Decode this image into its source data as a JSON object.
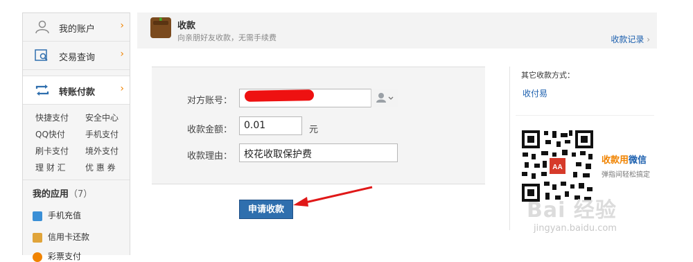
{
  "sidebar": {
    "nav": [
      {
        "label": "我的账户",
        "icon": "user-icon"
      },
      {
        "label": "交易查询",
        "icon": "search-doc-icon"
      },
      {
        "label": "转账付款",
        "icon": "transfer-icon"
      }
    ],
    "quick_links": [
      "快捷支付",
      "安全中心",
      "QQ快付",
      "手机支付",
      "刷卡支付",
      "境外支付",
      "理 财 汇",
      "优 惠 券"
    ],
    "apps_title": "我的应用",
    "apps_count": "（7）",
    "apps": [
      {
        "label": "手机充值",
        "icon": "phone-recharge-icon",
        "color": "#3a8fd6"
      },
      {
        "label": "信用卡还款",
        "icon": "credit-card-icon",
        "color": "#e0a43a"
      },
      {
        "label": "彩票支付",
        "icon": "lottery-icon",
        "color": "#f08300"
      }
    ]
  },
  "header": {
    "title": "收款",
    "subtitle": "向亲朋好友收款，无需手续费",
    "history_link": "收款记录",
    "history_chevron": "›"
  },
  "form": {
    "account_label": "对方账号：",
    "amount_label": "收款金额：",
    "amount_value": "0.01",
    "amount_unit": "元",
    "reason_label": "收款理由：",
    "reason_value": "校花收取保护费",
    "submit_label": "申请收款"
  },
  "side": {
    "other_title": "其它收款方式：",
    "other_link": "收付易",
    "promo_title_a": "收款用",
    "promo_title_b": "微信",
    "promo_sub": "弹指间轻松搞定",
    "qr_badge": "AA"
  },
  "watermark": {
    "main": "Bai 经验",
    "url": "jingyan.baidu.com"
  },
  "colors": {
    "accent": "#f08300",
    "link": "#1b5fae",
    "button": "#2f6fae",
    "arrow": "#e01818"
  }
}
